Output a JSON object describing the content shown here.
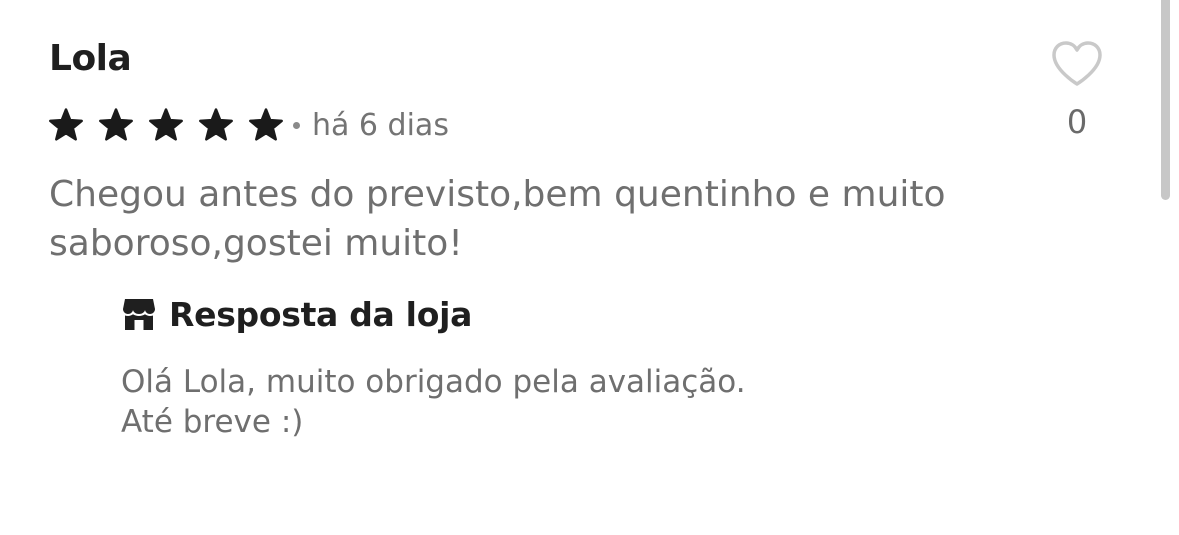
{
  "review": {
    "author": "Lola",
    "rating": 5,
    "max_rating": 5,
    "time_ago": "há 6 dias",
    "comment": "Chegou antes do previsto,bem quentinho e muito saboroso,gostei muito!",
    "likes": "0",
    "icons": {
      "star": "star-icon",
      "like": "heart-icon",
      "store": "store-icon"
    }
  },
  "store_reply": {
    "title": "Resposta da loja",
    "text": "Olá Lola, muito obrigado pela avaliação.\nAté breve :)"
  },
  "colors": {
    "text_primary": "#1f1f1f",
    "text_secondary": "#6f6f6f",
    "heart_outline": "#c9c9c9"
  }
}
